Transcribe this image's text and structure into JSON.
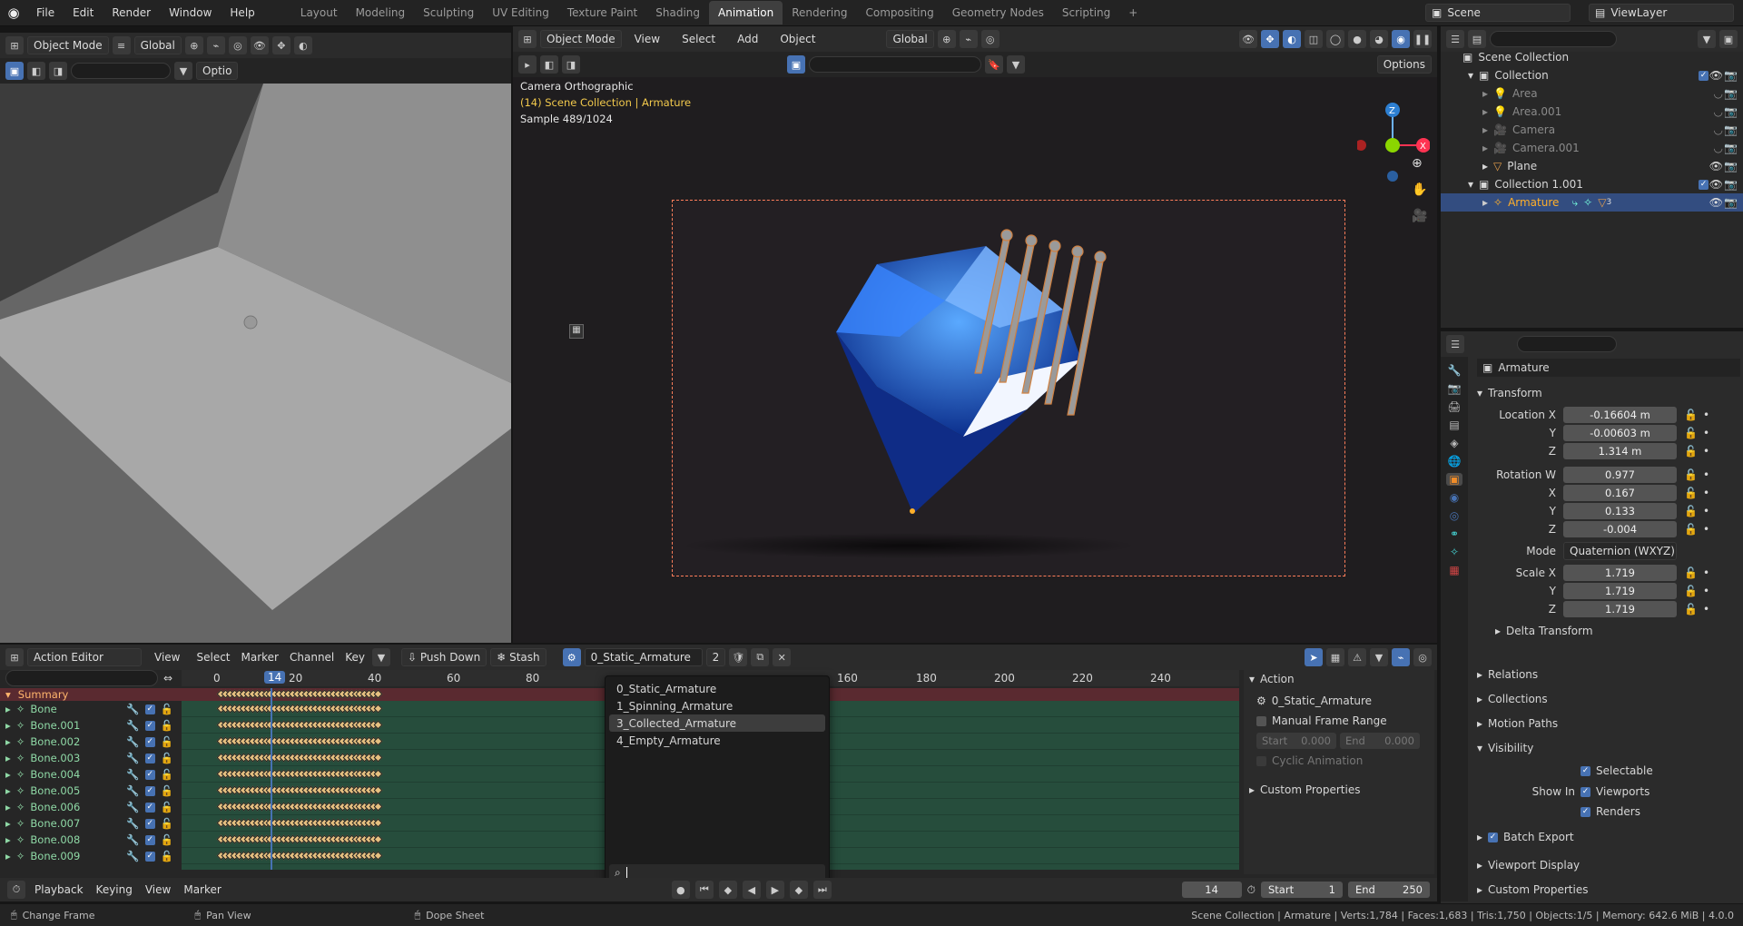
{
  "menus": [
    "File",
    "Edit",
    "Render",
    "Window",
    "Help"
  ],
  "workspaces": [
    "Layout",
    "Modeling",
    "Sculpting",
    "UV Editing",
    "Texture Paint",
    "Shading",
    "Animation",
    "Rendering",
    "Compositing",
    "Geometry Nodes",
    "Scripting"
  ],
  "active_workspace": "Animation",
  "scene": {
    "label": "Scene",
    "viewlayer": "ViewLayer"
  },
  "left_view": {
    "mode": "Object Mode",
    "orientation": "Global",
    "options": "Optio"
  },
  "viewport": {
    "mode": "Object Mode",
    "orientation": "Global",
    "menus": [
      "View",
      "Select",
      "Add",
      "Object"
    ],
    "options": "Options",
    "info_line1": "Camera Orthographic",
    "info_line2": "(14) Scene Collection | Armature",
    "info_line3": "Sample 489/1024"
  },
  "outliner": {
    "root": "Scene Collection",
    "rows": [
      {
        "label": "Collection",
        "level": 1
      },
      {
        "label": "Area",
        "level": 2
      },
      {
        "label": "Area.001",
        "level": 2
      },
      {
        "label": "Camera",
        "level": 2
      },
      {
        "label": "Camera.001",
        "level": 2
      },
      {
        "label": "Plane",
        "level": 2
      },
      {
        "label": "Collection 1.001",
        "level": 1
      },
      {
        "label": "Armature",
        "level": 2
      }
    ],
    "armature_badge": "3"
  },
  "properties": {
    "object_name": "Armature",
    "transform_title": "Transform",
    "location_label": "Location X",
    "location": [
      "-0.16604 m",
      "-0.00603 m",
      "1.314 m"
    ],
    "rotation_label": "Rotation W",
    "rotation": [
      "0.977",
      "0.167",
      "0.133",
      "-0.004"
    ],
    "mode_label": "Mode",
    "mode": "Quaternion (WXYZ)",
    "scale_label": "Scale X",
    "scale": [
      "1.719",
      "1.719",
      "1.719"
    ],
    "axis": {
      "y": "Y",
      "z": "Z",
      "x": "X"
    },
    "sections": [
      "Delta Transform",
      "Relations",
      "Collections",
      "Motion Paths"
    ],
    "visibility_title": "Visibility",
    "selectable": "Selectable",
    "show_in": "Show In",
    "viewports": "Viewports",
    "renders": "Renders",
    "batch_export": "Batch Export",
    "viewport_display": "Viewport Display",
    "custom_props": "Custom Properties"
  },
  "action_editor": {
    "editor": "Action Editor",
    "menus": [
      "View",
      "Select",
      "Marker",
      "Channel",
      "Key"
    ],
    "push_down": "Push Down",
    "stash": "Stash",
    "action_name": "0_Static_Armature",
    "users": "2",
    "ruler": [
      "0",
      "14",
      "20",
      "40",
      "60",
      "80",
      "160",
      "180",
      "200",
      "220",
      "240"
    ],
    "current_frame": "14",
    "summary": "Summary",
    "channels": [
      "Bone",
      "Bone.001",
      "Bone.002",
      "Bone.003",
      "Bone.004",
      "Bone.005",
      "Bone.006",
      "Bone.007",
      "Bone.008",
      "Bone.009"
    ],
    "dropdown": [
      "0_Static_Armature",
      "1_Spinning_Armature",
      "3_Collected_Armature",
      "4_Empty_Armature"
    ],
    "dropdown_highlight": "3_Collected_Armature",
    "side_action_title": "Action",
    "side_action_name": "0_Static_Armature",
    "manual_range": "Manual Frame Range",
    "start_label": "Start",
    "start_val": "0.000",
    "end_label": "End",
    "end_val": "0.000",
    "cyclic": "Cyclic Animation",
    "custom_props": "Custom Properties"
  },
  "timeline": {
    "menus": [
      "Playback",
      "Keying",
      "View",
      "Marker"
    ],
    "frame": "14",
    "start_label": "Start",
    "start": "1",
    "end_label": "End",
    "end": "250"
  },
  "statusbar": {
    "hints": [
      "Change Frame",
      "Pan View",
      "Dope Sheet"
    ],
    "stats": "Scene Collection | Armature | Verts:1,784 | Faces:1,683 | Tris:1,750 | Objects:1/5 | Memory: 642.6 MiB | 4.0.0"
  },
  "colors": {
    "accent": "#4772b3",
    "selected_text": "#ffaf29",
    "keyframe": "#e5c080",
    "playhead": "#4772b3"
  }
}
